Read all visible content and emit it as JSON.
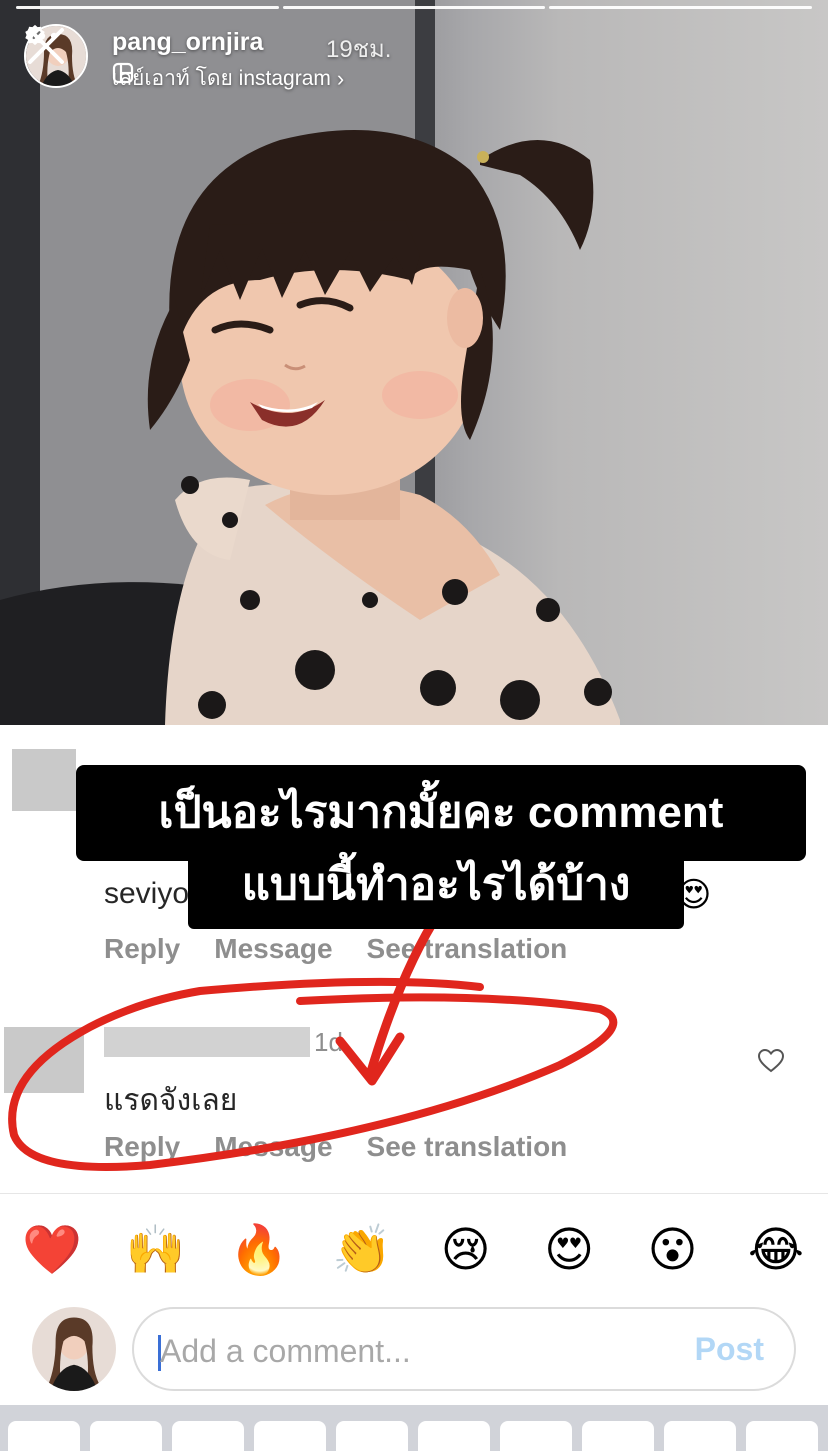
{
  "story": {
    "username": "pang_ornjira",
    "time_ago": "19ชม.",
    "layout_label": "เลย์เอาท์ โดย instagram",
    "progress_segments": 3,
    "active_segment": 1
  },
  "screenshot": {
    "comment1": {
      "text_partial": "seviyo",
      "actions": [
        "Reply",
        "Message",
        "See translation"
      ]
    },
    "comment2": {
      "time": "1d",
      "text": "แรดจังเลย",
      "actions": [
        "Reply",
        "Message",
        "See translation"
      ]
    },
    "banner": {
      "line1": "เป็นอะไรมากมั้ยคะ comment",
      "line2": "แบบนี้ทำอะไรได้บ้าง"
    }
  },
  "reactions": [
    "❤️",
    "🙌",
    "🔥",
    "👏",
    "😢",
    "😍",
    "😮",
    "😂"
  ],
  "comment_input": {
    "placeholder": "Add a comment...",
    "post_label": "Post"
  },
  "colors": {
    "annotation_red": "#e0261d",
    "post_disabled": "#b2d7f6",
    "caret": "#3a6fd6"
  }
}
